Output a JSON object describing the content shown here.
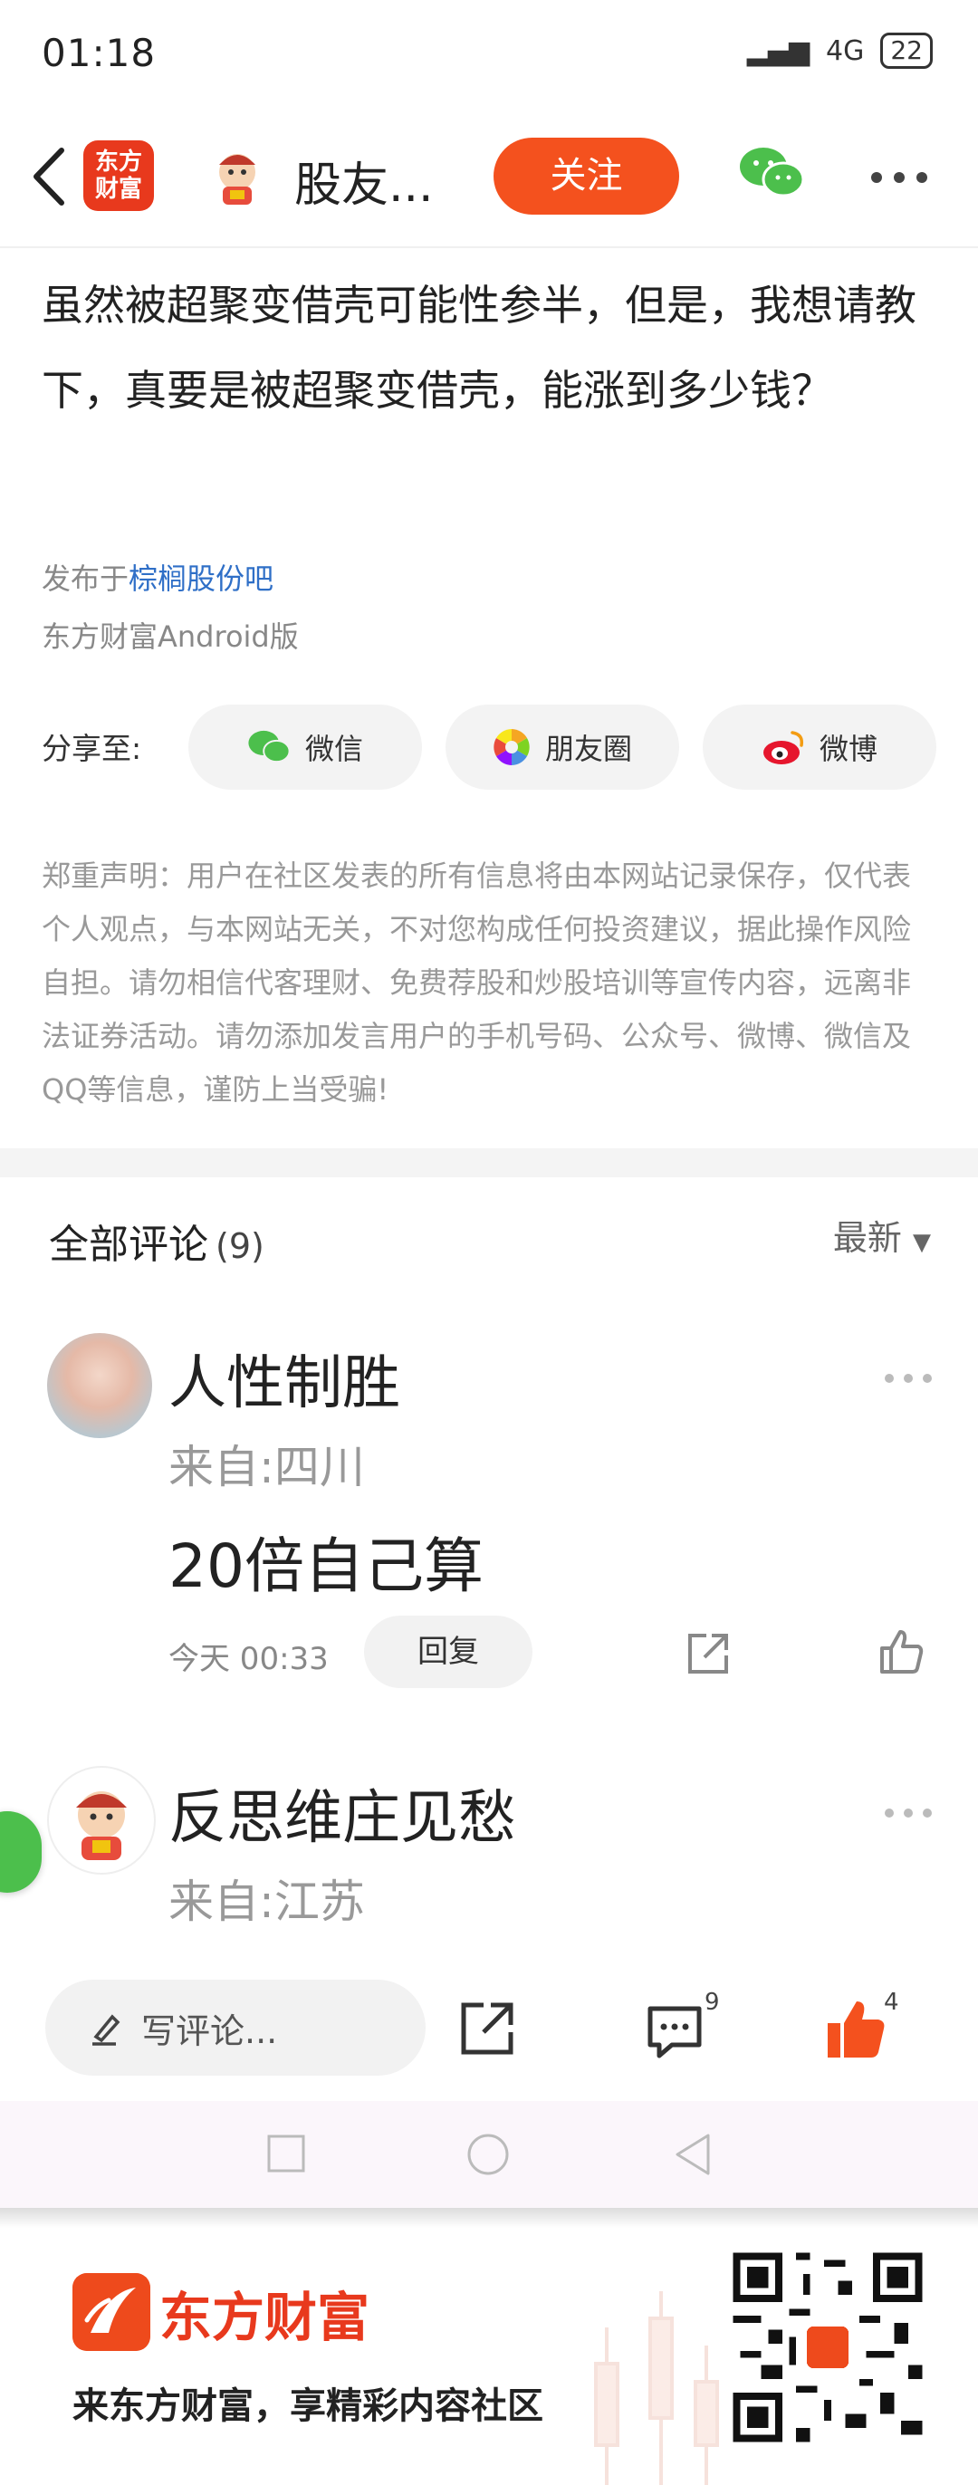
{
  "status_bar": {
    "time": "01:18",
    "network": "4G",
    "battery": "22"
  },
  "header": {
    "logo_line1": "东方",
    "logo_line2": "财富",
    "title": "股友...",
    "follow_label": "关注"
  },
  "post": {
    "body": "虽然被超聚变借壳可能性参半，但是，我想请教下，真要是被超聚变借壳，能涨到多少钱？",
    "published_prefix": "发布于",
    "forum_link": "棕榈股份吧",
    "client": "东方财富Android版",
    "share_label": "分享至:",
    "share_targets": [
      {
        "label": "微信",
        "icon": "wechat-icon"
      },
      {
        "label": "朋友圈",
        "icon": "moments-icon"
      },
      {
        "label": "微博",
        "icon": "weibo-icon"
      }
    ],
    "disclaimer": "郑重声明：用户在社区发表的所有信息将由本网站记录保存，仅代表个人观点，与本网站无关，不对您构成任何投资建议，据此操作风险自担。请勿相信代客理财、免费荐股和炒股培训等宣传内容，远离非法证券活动。请勿添加发言用户的手机号码、公众号、微博、微信及QQ等信息，谨防上当受骗!"
  },
  "comments": {
    "title": "全部评论",
    "count": "(9)",
    "sort_label": "最新",
    "items": [
      {
        "name": "人性制胜",
        "from": "来自:四川",
        "text": "20倍自己算",
        "time": "今天 00:33",
        "reply_label": "回复"
      },
      {
        "name": "反思维庄见愁",
        "from": "来自:江苏"
      }
    ]
  },
  "bottom_bar": {
    "write_placeholder": "写评论...",
    "comment_count": "9",
    "like_count": "4"
  },
  "footer": {
    "brand": "东方财富",
    "slogan": "来东方财富，享精彩内容社区"
  },
  "colors": {
    "accent": "#f4511e",
    "link": "#2f6fc7",
    "brand": "#e8391d"
  }
}
